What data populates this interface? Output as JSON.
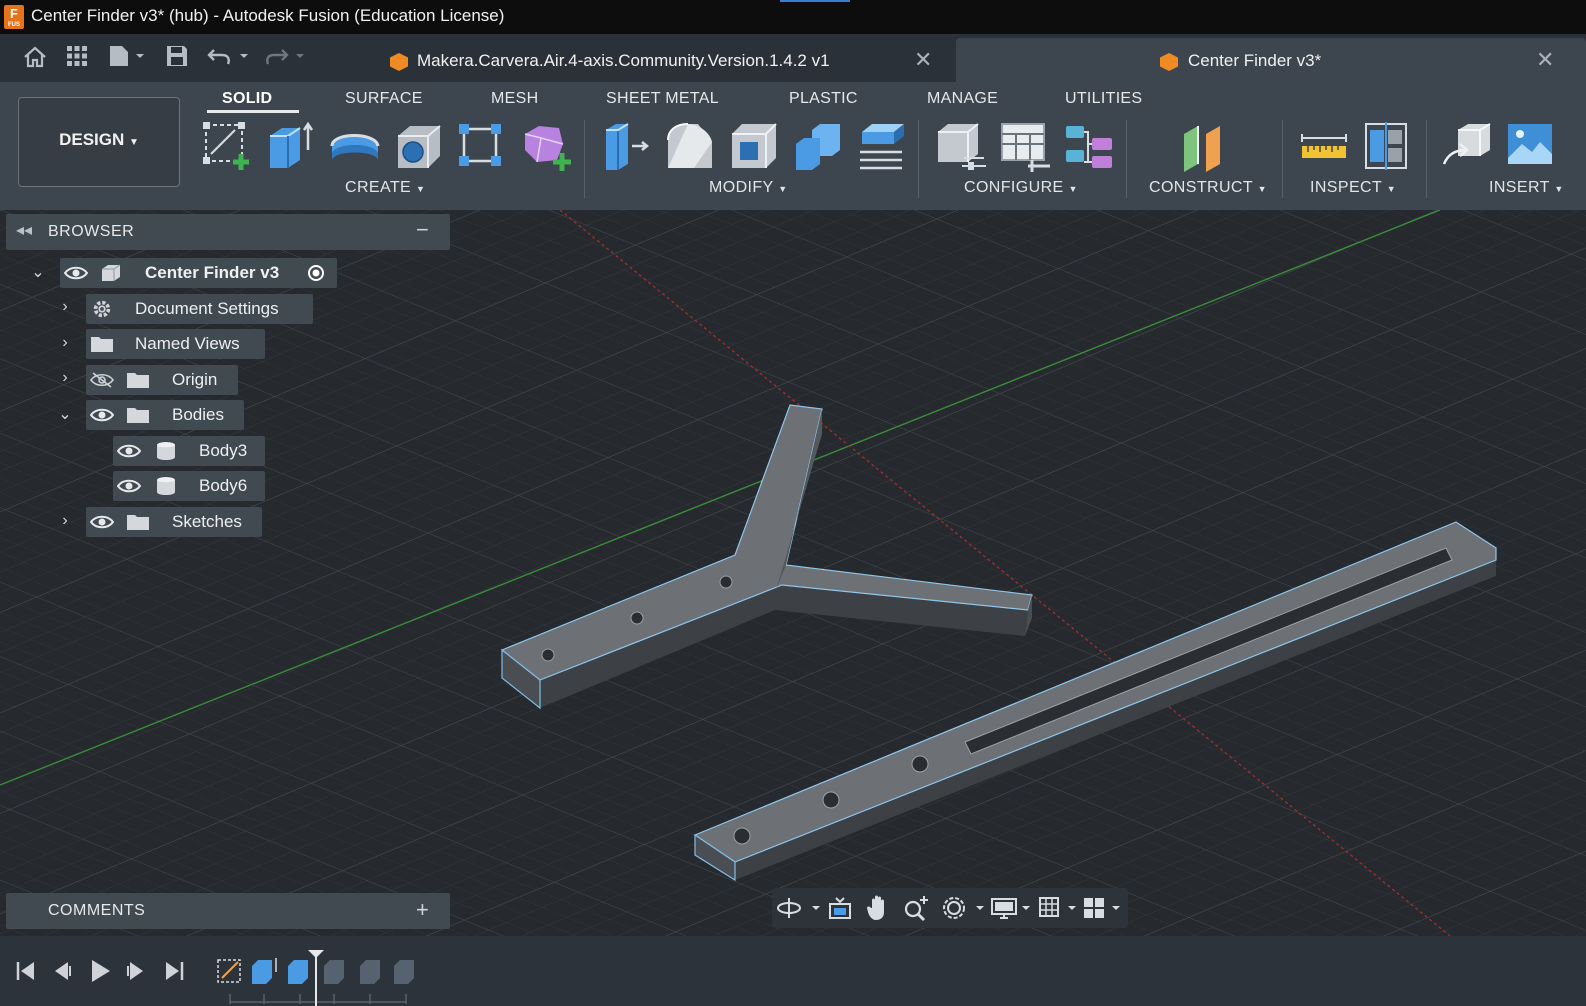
{
  "window": {
    "title": "Center Finder v3* (hub) - Autodesk Fusion (Education License)",
    "app_icon": "F"
  },
  "tabs": [
    {
      "label": "Makera.Carvera.Air.4-axis.Community.Version.1.4.2 v1",
      "active": false
    },
    {
      "label": "Center Finder v3*",
      "active": true
    }
  ],
  "quick_access": [
    "home-icon",
    "grid-icon",
    "file-icon",
    "save-icon",
    "undo-icon",
    "redo-icon"
  ],
  "toolbar": {
    "workspace": "DESIGN",
    "workspace_tabs": [
      "SOLID",
      "SURFACE",
      "MESH",
      "SHEET METAL",
      "PLASTIC",
      "MANAGE",
      "UTILITIES"
    ],
    "active_tab": "SOLID",
    "groups": [
      "CREATE",
      "MODIFY",
      "CONFIGURE",
      "CONSTRUCT",
      "INSPECT",
      "INSERT"
    ]
  },
  "browser": {
    "title": "BROWSER",
    "root": "Center Finder v3",
    "items": [
      {
        "label": "Document Settings"
      },
      {
        "label": "Named Views"
      },
      {
        "label": "Origin"
      },
      {
        "label": "Bodies"
      },
      {
        "label": "Body3"
      },
      {
        "label": "Body6"
      },
      {
        "label": "Sketches"
      }
    ]
  },
  "comments": {
    "title": "COMMENTS"
  },
  "colors": {
    "accent": "#3a7dd6",
    "toolbar_bg": "#3d454e",
    "viewport_bg": "#25282c",
    "body_edge": "#6cb4e4",
    "x_axis": "#b33a3a",
    "y_axis": "#3d9a3d"
  }
}
